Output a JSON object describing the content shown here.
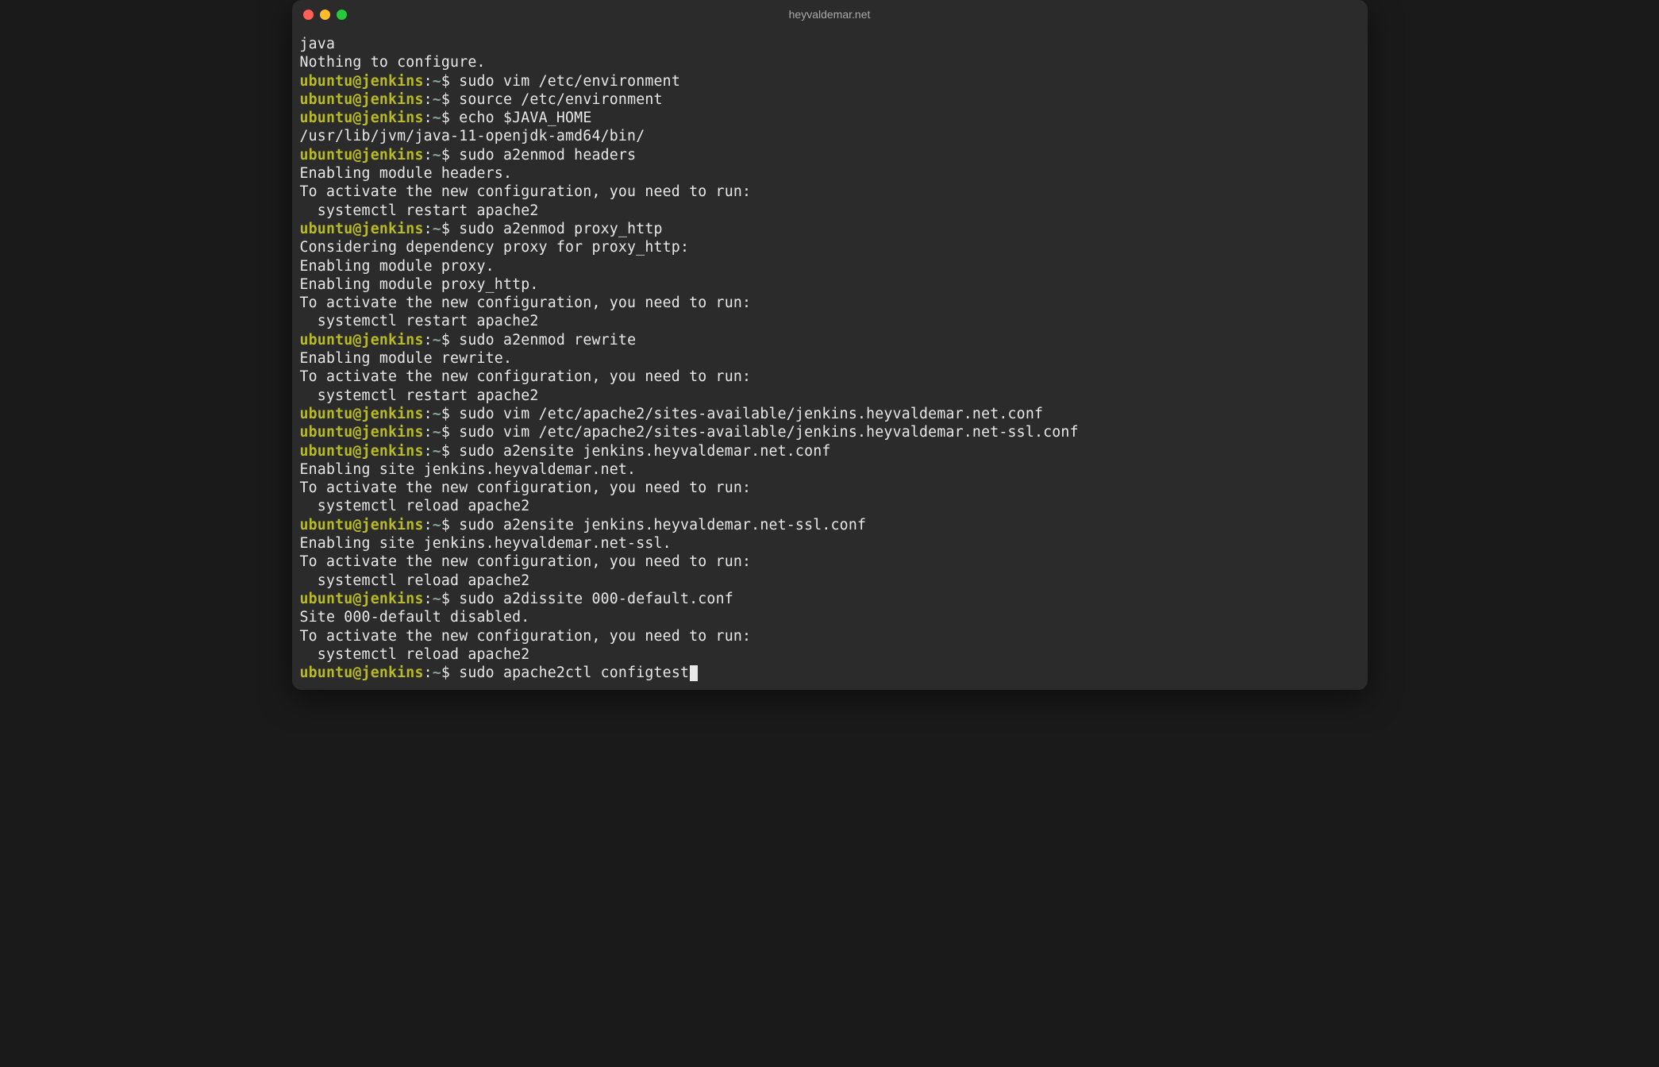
{
  "window": {
    "title": "heyvaldemar.net"
  },
  "prompt": {
    "user_host": "ubuntu@jenkins",
    "separator": ":",
    "path": "~",
    "symbol": "$"
  },
  "lines": [
    {
      "type": "output",
      "text": "java"
    },
    {
      "type": "output",
      "text": "Nothing to configure."
    },
    {
      "type": "prompt",
      "command": "sudo vim /etc/environment"
    },
    {
      "type": "prompt",
      "command": "source /etc/environment"
    },
    {
      "type": "prompt",
      "command": "echo $JAVA_HOME"
    },
    {
      "type": "output",
      "text": "/usr/lib/jvm/java-11-openjdk-amd64/bin/"
    },
    {
      "type": "prompt",
      "command": "sudo a2enmod headers"
    },
    {
      "type": "output",
      "text": "Enabling module headers."
    },
    {
      "type": "output",
      "text": "To activate the new configuration, you need to run:"
    },
    {
      "type": "output",
      "text": "  systemctl restart apache2"
    },
    {
      "type": "prompt",
      "command": "sudo a2enmod proxy_http"
    },
    {
      "type": "output",
      "text": "Considering dependency proxy for proxy_http:"
    },
    {
      "type": "output",
      "text": "Enabling module proxy."
    },
    {
      "type": "output",
      "text": "Enabling module proxy_http."
    },
    {
      "type": "output",
      "text": "To activate the new configuration, you need to run:"
    },
    {
      "type": "output",
      "text": "  systemctl restart apache2"
    },
    {
      "type": "prompt",
      "command": "sudo a2enmod rewrite"
    },
    {
      "type": "output",
      "text": "Enabling module rewrite."
    },
    {
      "type": "output",
      "text": "To activate the new configuration, you need to run:"
    },
    {
      "type": "output",
      "text": "  systemctl restart apache2"
    },
    {
      "type": "prompt",
      "command": "sudo vim /etc/apache2/sites-available/jenkins.heyvaldemar.net.conf"
    },
    {
      "type": "prompt",
      "command": "sudo vim /etc/apache2/sites-available/jenkins.heyvaldemar.net-ssl.conf"
    },
    {
      "type": "prompt",
      "command": "sudo a2ensite jenkins.heyvaldemar.net.conf"
    },
    {
      "type": "output",
      "text": "Enabling site jenkins.heyvaldemar.net."
    },
    {
      "type": "output",
      "text": "To activate the new configuration, you need to run:"
    },
    {
      "type": "output",
      "text": "  systemctl reload apache2"
    },
    {
      "type": "prompt",
      "command": "sudo a2ensite jenkins.heyvaldemar.net-ssl.conf"
    },
    {
      "type": "output",
      "text": "Enabling site jenkins.heyvaldemar.net-ssl."
    },
    {
      "type": "output",
      "text": "To activate the new configuration, you need to run:"
    },
    {
      "type": "output",
      "text": "  systemctl reload apache2"
    },
    {
      "type": "prompt",
      "command": "sudo a2dissite 000-default.conf"
    },
    {
      "type": "output",
      "text": "Site 000-default disabled."
    },
    {
      "type": "output",
      "text": "To activate the new configuration, you need to run:"
    },
    {
      "type": "output",
      "text": "  systemctl reload apache2"
    },
    {
      "type": "prompt",
      "command": "sudo apache2ctl configtest",
      "cursor": true
    }
  ]
}
